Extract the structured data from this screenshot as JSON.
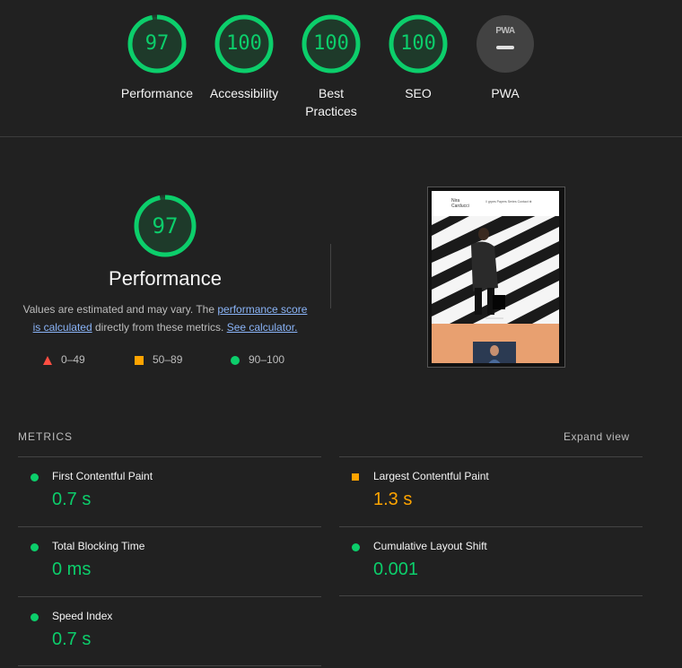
{
  "gauges": [
    {
      "score": "97",
      "label": "Performance",
      "value": 97,
      "color": "#0cce6b"
    },
    {
      "score": "100",
      "label": "Accessibility",
      "value": 100,
      "color": "#0cce6b"
    },
    {
      "score": "100",
      "label": "Best Practices",
      "value": 100,
      "color": "#0cce6b"
    },
    {
      "score": "100",
      "label": "SEO",
      "value": 100,
      "color": "#0cce6b"
    },
    {
      "score": "",
      "label": "PWA",
      "badge": "PWA"
    }
  ],
  "performance": {
    "score": "97",
    "value": 97,
    "title": "Performance",
    "desc_prefix": "Values are estimated and may vary. The ",
    "link1": "performance score is calculated",
    "desc_middle": " directly from these metrics. ",
    "link2": "See calculator."
  },
  "legend": {
    "fail": "0–49",
    "average": "50–89",
    "pass": "90–100"
  },
  "thumbnail": {
    "name_line1": "Nira",
    "name_line2": "Carducci",
    "nav": "// grpes   Papers   Series   Contact   ⊕"
  },
  "metrics": {
    "title": "METRICS",
    "expand": "Expand view",
    "items": [
      {
        "name": "First Contentful Paint",
        "value": "0.7 s",
        "status": "pass"
      },
      {
        "name": "Largest Contentful Paint",
        "value": "1.3 s",
        "status": "average"
      },
      {
        "name": "Total Blocking Time",
        "value": "0 ms",
        "status": "pass"
      },
      {
        "name": "Cumulative Layout Shift",
        "value": "0.001",
        "status": "pass"
      },
      {
        "name": "Speed Index",
        "value": "0.7 s",
        "status": "pass"
      }
    ]
  },
  "colors": {
    "pass": "#0cce6b",
    "average": "#ffa400",
    "fail": "#ff4e42",
    "background": "#212121"
  }
}
